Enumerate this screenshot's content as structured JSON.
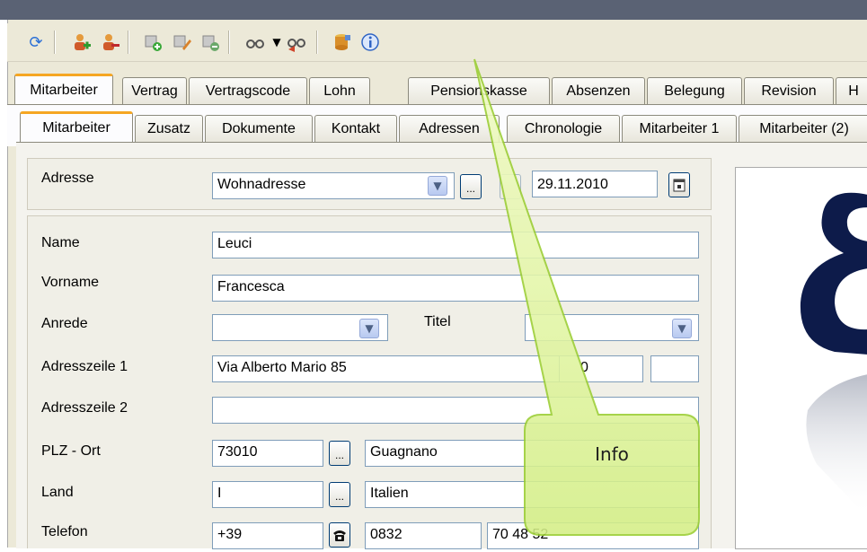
{
  "toolbar": {
    "icons": [
      "refresh-icon",
      "add-user-icon",
      "remove-user-icon",
      "add-item-icon",
      "edit-item-icon",
      "delete-item-icon",
      "glasses-icon",
      "dropdown-arrow-icon",
      "glasses-back-icon",
      "database-icon",
      "info-icon"
    ]
  },
  "main_tabs": [
    "Mitarbeiter",
    "Vertrag",
    "Vertragscode",
    "Lohn",
    "Pensionskasse",
    "Absenzen",
    "Belegung",
    "Revision",
    "H"
  ],
  "sub_tabs": [
    "Mitarbeiter",
    "Zusatz",
    "Dokumente",
    "Kontakt",
    "Adressen",
    "Chronologie",
    "Mitarbeiter 1",
    "Mitarbeiter (2)"
  ],
  "address": {
    "label": "Adresse",
    "type_value": "Wohnadresse",
    "dots": "...",
    "date": "29.11.2010"
  },
  "form": {
    "name_label": "Name",
    "name_value": "Leuci",
    "vorname_label": "Vorname",
    "vorname_value": "Francesca",
    "anrede_label": "Anrede",
    "anrede_value": "",
    "titel_label": "Titel",
    "titel_value": "",
    "adresse1_label": "Adresszeile 1",
    "adresse1_value": "Via Alberto Mario 85",
    "adresse1_extra": "0",
    "adresse2_label": "Adresszeile 2",
    "adresse2_value": "",
    "plz_label": "PLZ - Ort",
    "plz_value": "73010",
    "ort_value": "Guagnano",
    "land_label": "Land",
    "land_code": "I",
    "land_value": "Italien",
    "telefon_label": "Telefon",
    "telefon_code": "+39",
    "telefon_area": "0832",
    "telefon_number": "70 48 52",
    "dots": "..."
  },
  "callout": {
    "text": "Info"
  },
  "colors": {
    "callout_fill": "#e6f7a6",
    "callout_border": "#9acd32",
    "tab_accent": "#f5a623",
    "field_border": "#7f9db9",
    "window_bg": "#ece9d8"
  }
}
